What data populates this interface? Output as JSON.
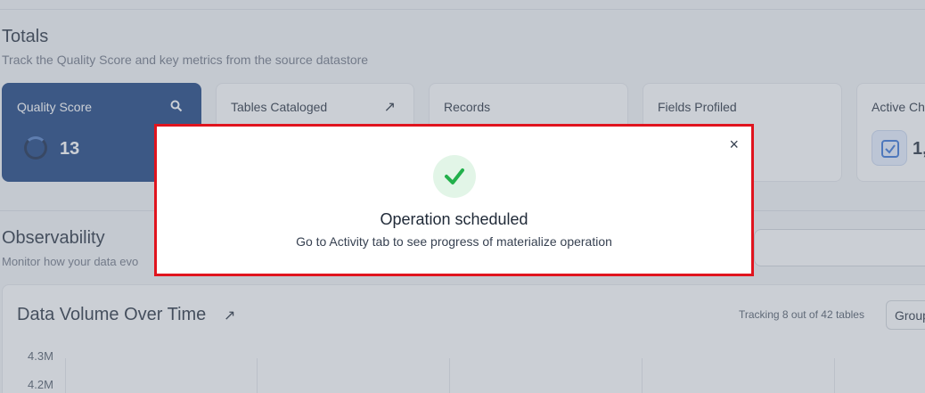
{
  "totals": {
    "title": "Totals",
    "subtitle": "Track the Quality Score and key metrics from the source datastore"
  },
  "cards": {
    "quality_score": {
      "label": "Quality Score",
      "value": "13",
      "icon": "search-icon"
    },
    "tables_cataloged": {
      "label": "Tables Cataloged",
      "icon": "arrow-up-right-icon"
    },
    "records": {
      "label": "Records"
    },
    "fields_profiled": {
      "label": "Fields Profiled"
    },
    "active_checks": {
      "label": "Active Ch",
      "value": "1,",
      "icon": "check-square-icon"
    }
  },
  "observability": {
    "title": "Observability",
    "subtitle": "Monitor how your data evo"
  },
  "chart_panel": {
    "title": "Data Volume Over Time",
    "tracking": "Tracking 8 out of 42 tables",
    "group_select_value": "Group",
    "y_ticks": [
      "4.3M",
      "4.2M"
    ]
  },
  "modal": {
    "title": "Operation scheduled",
    "message": "Go to Activity tab to see progress of materialize operation",
    "close_symbol": "×",
    "icon": "checkmark-icon"
  },
  "colors": {
    "brand_blue": "#123a7a",
    "success_green": "#22b04b",
    "highlight_red": "#e0141e"
  }
}
